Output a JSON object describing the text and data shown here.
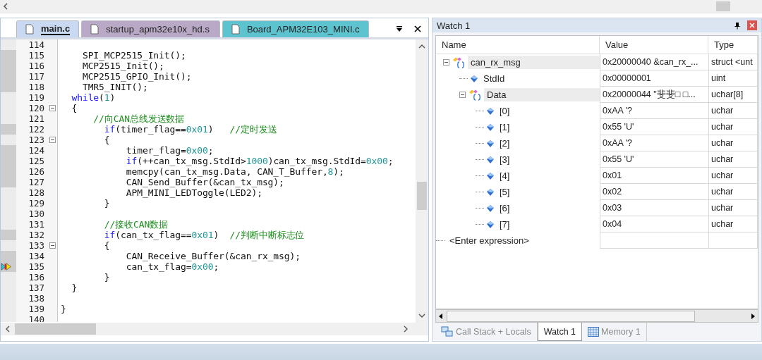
{
  "editor": {
    "tabs": [
      {
        "label": "main.c",
        "selected": true,
        "color": "#c9d9f2"
      },
      {
        "label": "startup_apm32e10x_hd.s",
        "selected": false,
        "color": "#b9a9c6"
      },
      {
        "label": "Board_APM32E103_MINI.c",
        "selected": false,
        "color": "#5cc3cf"
      }
    ],
    "lines": [
      {
        "number": "114",
        "executable": false,
        "foldable": false,
        "current": false
      },
      {
        "number": "115",
        "executable": true,
        "foldable": false,
        "current": false,
        "tokens": [
          {
            "kind": "plain",
            "text": "    SPI_MCP2515_Init();"
          }
        ]
      },
      {
        "number": "116",
        "executable": true,
        "foldable": false,
        "current": false,
        "tokens": [
          {
            "kind": "plain",
            "text": "    MCP2515_Init();"
          }
        ]
      },
      {
        "number": "117",
        "executable": true,
        "foldable": false,
        "current": false,
        "tokens": [
          {
            "kind": "plain",
            "text": "    MCP2515_GPIO_Init();"
          }
        ]
      },
      {
        "number": "118",
        "executable": true,
        "foldable": false,
        "current": false,
        "tokens": [
          {
            "kind": "plain",
            "text": "    TMR5_INIT();"
          }
        ]
      },
      {
        "number": "119",
        "executable": false,
        "foldable": false,
        "current": false,
        "tokens": [
          {
            "kind": "keyword",
            "text": "  while"
          },
          {
            "kind": "plain",
            "text": "("
          },
          {
            "kind": "number",
            "text": "1"
          },
          {
            "kind": "plain",
            "text": ")"
          }
        ]
      },
      {
        "number": "120",
        "executable": false,
        "foldable": true,
        "current": false,
        "tokens": [
          {
            "kind": "plain",
            "text": "  {"
          }
        ]
      },
      {
        "number": "121",
        "executable": false,
        "foldable": false,
        "current": false,
        "tokens": [
          {
            "kind": "comment",
            "text": "      //向CAN总线发送数据"
          }
        ]
      },
      {
        "number": "122",
        "executable": true,
        "foldable": false,
        "current": false,
        "tokens": [
          {
            "kind": "keyword",
            "text": "        if"
          },
          {
            "kind": "plain",
            "text": "(timer_flag=="
          },
          {
            "kind": "number",
            "text": "0x01"
          },
          {
            "kind": "plain",
            "text": ")   "
          },
          {
            "kind": "comment",
            "text": "//定时发送"
          }
        ]
      },
      {
        "number": "123",
        "executable": false,
        "foldable": true,
        "current": false,
        "tokens": [
          {
            "kind": "plain",
            "text": "        {"
          }
        ]
      },
      {
        "number": "124",
        "executable": true,
        "foldable": false,
        "current": false,
        "tokens": [
          {
            "kind": "plain",
            "text": "            timer_flag="
          },
          {
            "kind": "number",
            "text": "0x00"
          },
          {
            "kind": "plain",
            "text": ";"
          }
        ]
      },
      {
        "number": "125",
        "executable": true,
        "foldable": false,
        "current": false,
        "tokens": [
          {
            "kind": "keyword",
            "text": "            if"
          },
          {
            "kind": "plain",
            "text": "(++can_tx_msg.StdId>"
          },
          {
            "kind": "number",
            "text": "1000"
          },
          {
            "kind": "plain",
            "text": ")can_tx_msg.StdId="
          },
          {
            "kind": "number",
            "text": "0x00"
          },
          {
            "kind": "plain",
            "text": ";"
          }
        ]
      },
      {
        "number": "126",
        "executable": true,
        "foldable": false,
        "current": false,
        "tokens": [
          {
            "kind": "plain",
            "text": "            memcpy(can_tx_msg.Data, CAN_T_Buffer,"
          },
          {
            "kind": "number",
            "text": "8"
          },
          {
            "kind": "plain",
            "text": ");"
          }
        ]
      },
      {
        "number": "127",
        "executable": true,
        "foldable": false,
        "current": false,
        "tokens": [
          {
            "kind": "plain",
            "text": "            CAN_Send_Buffer(&can_tx_msg);"
          }
        ]
      },
      {
        "number": "128",
        "executable": false,
        "foldable": false,
        "current": false,
        "tokens": [
          {
            "kind": "plain",
            "text": "            APM_MINI_LEDToggle(LED2);"
          }
        ]
      },
      {
        "number": "129",
        "executable": false,
        "foldable": false,
        "current": false,
        "tokens": [
          {
            "kind": "plain",
            "text": "        }"
          }
        ]
      },
      {
        "number": "130",
        "executable": false,
        "foldable": false,
        "current": false
      },
      {
        "number": "131",
        "executable": false,
        "foldable": false,
        "current": false,
        "tokens": [
          {
            "kind": "comment",
            "text": "        //接收CAN数据"
          }
        ]
      },
      {
        "number": "132",
        "executable": true,
        "foldable": false,
        "current": false,
        "tokens": [
          {
            "kind": "keyword",
            "text": "        if"
          },
          {
            "kind": "plain",
            "text": "(can_tx_flag=="
          },
          {
            "kind": "number",
            "text": "0x01"
          },
          {
            "kind": "plain",
            "text": ")  "
          },
          {
            "kind": "comment",
            "text": "//判断中断标志位"
          }
        ]
      },
      {
        "number": "133",
        "executable": false,
        "foldable": true,
        "current": false,
        "tokens": [
          {
            "kind": "plain",
            "text": "        {"
          }
        ]
      },
      {
        "number": "134",
        "executable": true,
        "foldable": false,
        "current": false,
        "tokens": [
          {
            "kind": "plain",
            "text": "            CAN_Receive_Buffer(&can_rx_msg);"
          }
        ]
      },
      {
        "number": "135",
        "executable": true,
        "foldable": false,
        "current": true,
        "tokens": [
          {
            "kind": "plain",
            "text": "            can_tx_flag="
          },
          {
            "kind": "number",
            "text": "0x00"
          },
          {
            "kind": "plain",
            "text": ";"
          }
        ]
      },
      {
        "number": "136",
        "executable": false,
        "foldable": false,
        "current": false,
        "tokens": [
          {
            "kind": "plain",
            "text": "        }"
          }
        ]
      },
      {
        "number": "137",
        "executable": false,
        "foldable": false,
        "current": false,
        "tokens": [
          {
            "kind": "plain",
            "text": "  }"
          }
        ]
      },
      {
        "number": "138",
        "executable": false,
        "foldable": false,
        "current": false
      },
      {
        "number": "139",
        "executable": false,
        "foldable": false,
        "current": false,
        "tokens": [
          {
            "kind": "plain",
            "text": "}"
          }
        ]
      },
      {
        "number": "140",
        "executable": false,
        "foldable": false,
        "current": false
      }
    ]
  },
  "watch": {
    "title": "Watch 1",
    "columns": [
      "Name",
      "Value",
      "Type"
    ],
    "items": [
      {
        "name": "can_rx_msg",
        "kind": "struct",
        "value": "0x20000040 &can_rx_...",
        "type": "struct <unt",
        "expanded": true,
        "children": [
          {
            "name": "StdId",
            "kind": "scalar",
            "value": "0x00000001",
            "type": "uint"
          },
          {
            "name": "Data",
            "kind": "struct",
            "value": "0x20000044 \"斐斐□ □...",
            "type": "uchar[8]",
            "expanded": true,
            "children": [
              {
                "name": "[0]",
                "kind": "scalar",
                "value": "0xAA '?",
                "type": "uchar"
              },
              {
                "name": "[1]",
                "kind": "scalar",
                "value": "0x55 'U'",
                "type": "uchar"
              },
              {
                "name": "[2]",
                "kind": "scalar",
                "value": "0xAA '?",
                "type": "uchar"
              },
              {
                "name": "[3]",
                "kind": "scalar",
                "value": "0x55 'U'",
                "type": "uchar"
              },
              {
                "name": "[4]",
                "kind": "scalar",
                "value": "0x01",
                "type": "uchar"
              },
              {
                "name": "[5]",
                "kind": "scalar",
                "value": "0x02",
                "type": "uchar"
              },
              {
                "name": "[6]",
                "kind": "scalar",
                "value": "0x03",
                "type": "uchar"
              },
              {
                "name": "[7]",
                "kind": "scalar",
                "value": "0x04",
                "type": "uchar"
              }
            ]
          }
        ]
      }
    ],
    "add_row": "<Enter expression>",
    "tabs": [
      {
        "label": "Call Stack + Locals",
        "selected": false,
        "kind": "callstack"
      },
      {
        "label": "Watch 1",
        "selected": true,
        "kind": "watch"
      },
      {
        "label": "Memory 1",
        "selected": false,
        "kind": "memory"
      }
    ]
  }
}
